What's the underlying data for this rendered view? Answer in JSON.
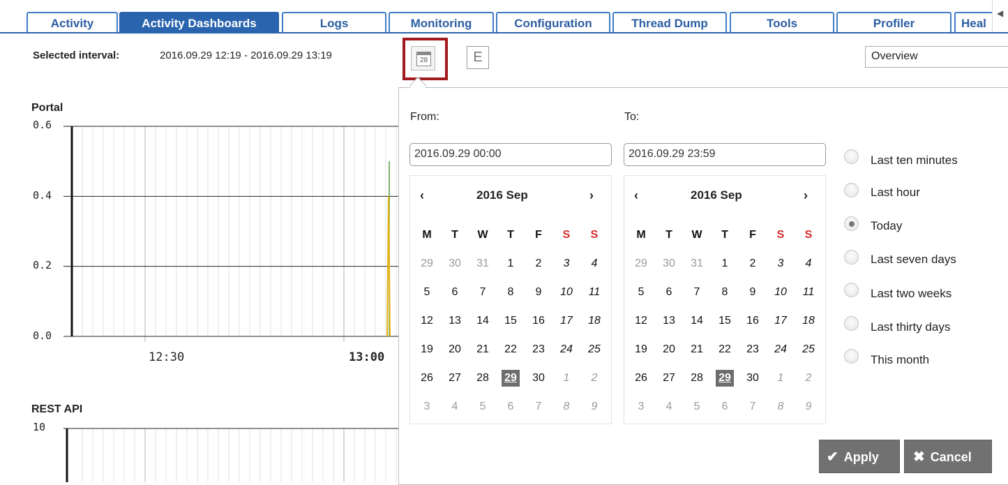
{
  "tabs": [
    {
      "label": "Activity"
    },
    {
      "label": "Activity Dashboards",
      "active": true
    },
    {
      "label": "Logs"
    },
    {
      "label": "Monitoring"
    },
    {
      "label": "Configuration"
    },
    {
      "label": "Thread Dump"
    },
    {
      "label": "Tools"
    },
    {
      "label": "Profiler"
    },
    {
      "label": "Heal"
    }
  ],
  "interval": {
    "label": "Selected interval:",
    "value": "2016.09.29 12:19 - 2016.09.29 13:19",
    "calendar_icon_day": "28",
    "e_button_label": "E"
  },
  "view_select": {
    "selected": "Overview"
  },
  "charts": [
    {
      "title": "Portal",
      "y_ticks": [
        "0.6",
        "0.4",
        "0.2",
        "0.0"
      ],
      "x_ticks": [
        "12:30",
        "13:00"
      ],
      "series_colors": [
        "#4a9a3b",
        "#e4b31a"
      ]
    },
    {
      "title": "REST API",
      "y_ticks": [
        "10"
      ]
    }
  ],
  "chart_data": [
    {
      "type": "line",
      "title": "Portal",
      "xlabel": "",
      "ylabel": "",
      "ylim": [
        0,
        0.6
      ],
      "x_ticks": [
        "12:30",
        "13:00"
      ],
      "series": [
        {
          "values_note": "",
          "color": "#4a9a3b",
          "x": [
            "12:58",
            "12:58"
          ],
          "y": [
            0.0,
            0.5
          ]
        },
        {
          "color": "#e4b31a",
          "x": [
            "12:58",
            "12:58"
          ],
          "y": [
            0.0,
            0.4
          ]
        }
      ],
      "grid": true
    },
    {
      "type": "line",
      "title": "REST API",
      "ylim": [
        0,
        10
      ],
      "y_ticks": [
        "10"
      ],
      "grid": true
    }
  ],
  "picker": {
    "from_label": "From:",
    "to_label": "To:",
    "from_value": "2016.09.29 00:00",
    "to_value": "2016.09.29 23:59",
    "prev_symbol": "‹",
    "next_symbol": "›",
    "weekday_headers": [
      "M",
      "T",
      "W",
      "T",
      "F",
      "S",
      "S"
    ],
    "calendars": [
      {
        "title": "2016 Sep",
        "weeks": [
          [
            "29",
            "30",
            "31",
            "1",
            "2",
            "3",
            "4"
          ],
          [
            "5",
            "6",
            "7",
            "8",
            "9",
            "10",
            "11"
          ],
          [
            "12",
            "13",
            "14",
            "15",
            "16",
            "17",
            "18"
          ],
          [
            "19",
            "20",
            "21",
            "22",
            "23",
            "24",
            "25"
          ],
          [
            "26",
            "27",
            "28",
            "29",
            "30",
            "1",
            "2"
          ],
          [
            "3",
            "4",
            "5",
            "6",
            "7",
            "8",
            "9"
          ]
        ],
        "selected_day": "29"
      },
      {
        "title": "2016 Sep",
        "weeks": [
          [
            "29",
            "30",
            "31",
            "1",
            "2",
            "3",
            "4"
          ],
          [
            "5",
            "6",
            "7",
            "8",
            "9",
            "10",
            "11"
          ],
          [
            "12",
            "13",
            "14",
            "15",
            "16",
            "17",
            "18"
          ],
          [
            "19",
            "20",
            "21",
            "22",
            "23",
            "24",
            "25"
          ],
          [
            "26",
            "27",
            "28",
            "29",
            "30",
            "1",
            "2"
          ],
          [
            "3",
            "4",
            "5",
            "6",
            "7",
            "8",
            "9"
          ]
        ],
        "selected_day": "29"
      }
    ],
    "presets": [
      {
        "label": "Last ten minutes",
        "checked": false
      },
      {
        "label": "Last hour",
        "checked": false
      },
      {
        "label": "Today",
        "checked": true
      },
      {
        "label": "Last seven days",
        "checked": false
      },
      {
        "label": "Last two weeks",
        "checked": false
      },
      {
        "label": "Last thirty days",
        "checked": false
      },
      {
        "label": "This month",
        "checked": false
      }
    ],
    "apply_label": "Apply",
    "cancel_label": "Cancel",
    "apply_icon": "check-icon",
    "cancel_icon": "x-icon"
  },
  "colors": {
    "tab_blue": "#2a63ae",
    "highlight_red": "#a11a1e",
    "weekend_red": "#d42a2a",
    "button_gray": "#717171"
  }
}
